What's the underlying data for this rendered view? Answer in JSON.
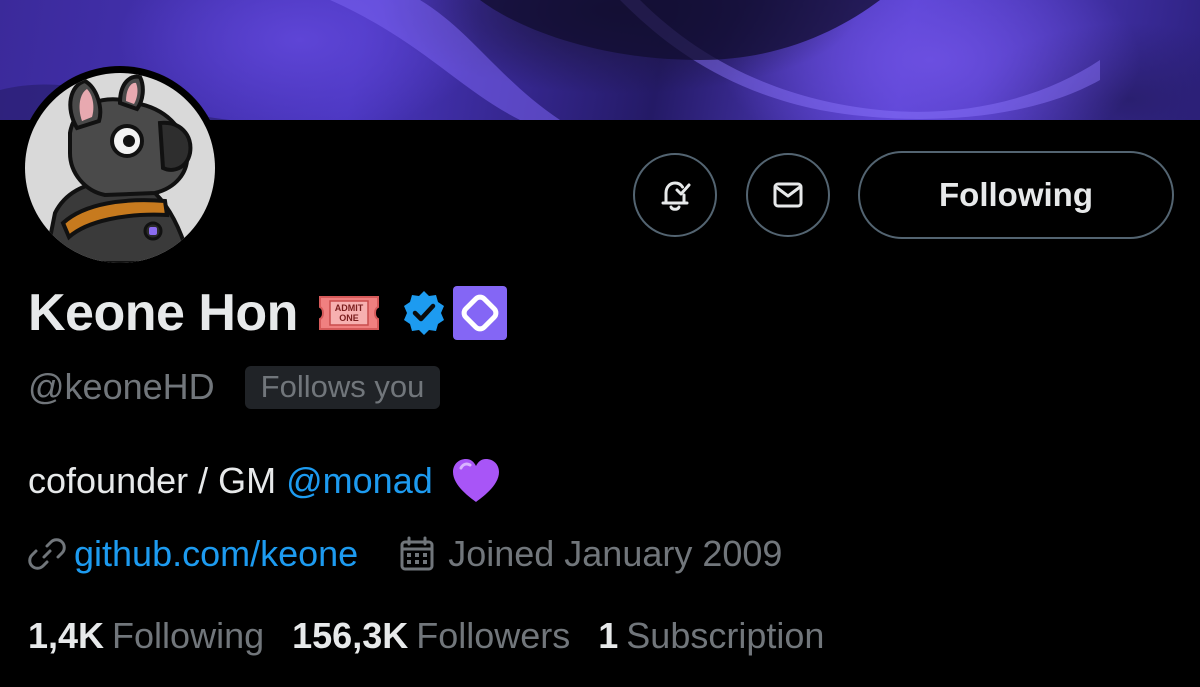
{
  "profile": {
    "name": "Keone Hon",
    "handle": "@keoneHD",
    "follows_you": "Follows you",
    "bio_text": "cofounder / GM",
    "bio_mention": "@monad",
    "website": "github.com/keone",
    "joined": "Joined January 2009"
  },
  "badges": {
    "ticket_line1": "ADMIT",
    "ticket_line2": "ONE"
  },
  "actions": {
    "following_label": "Following"
  },
  "stats": {
    "following_count": "1,4K",
    "following_label": "Following",
    "followers_count": "156,3K",
    "followers_label": "Followers",
    "subscription_count": "1",
    "subscription_label": "Subscription"
  },
  "colors": {
    "accent": "#1d9bf0",
    "muted": "#71767b",
    "text": "#e7e9ea",
    "background": "#000000",
    "banner": "#4a36c0"
  },
  "icons": {
    "notify": "bell-check-icon",
    "message": "mail-icon",
    "link": "link-icon",
    "calendar": "calendar-icon",
    "verified": "verified-badge-icon",
    "affiliate": "monad-logo-icon",
    "ticket": "admit-one-ticket-icon",
    "heart": "purple-heart-icon"
  }
}
